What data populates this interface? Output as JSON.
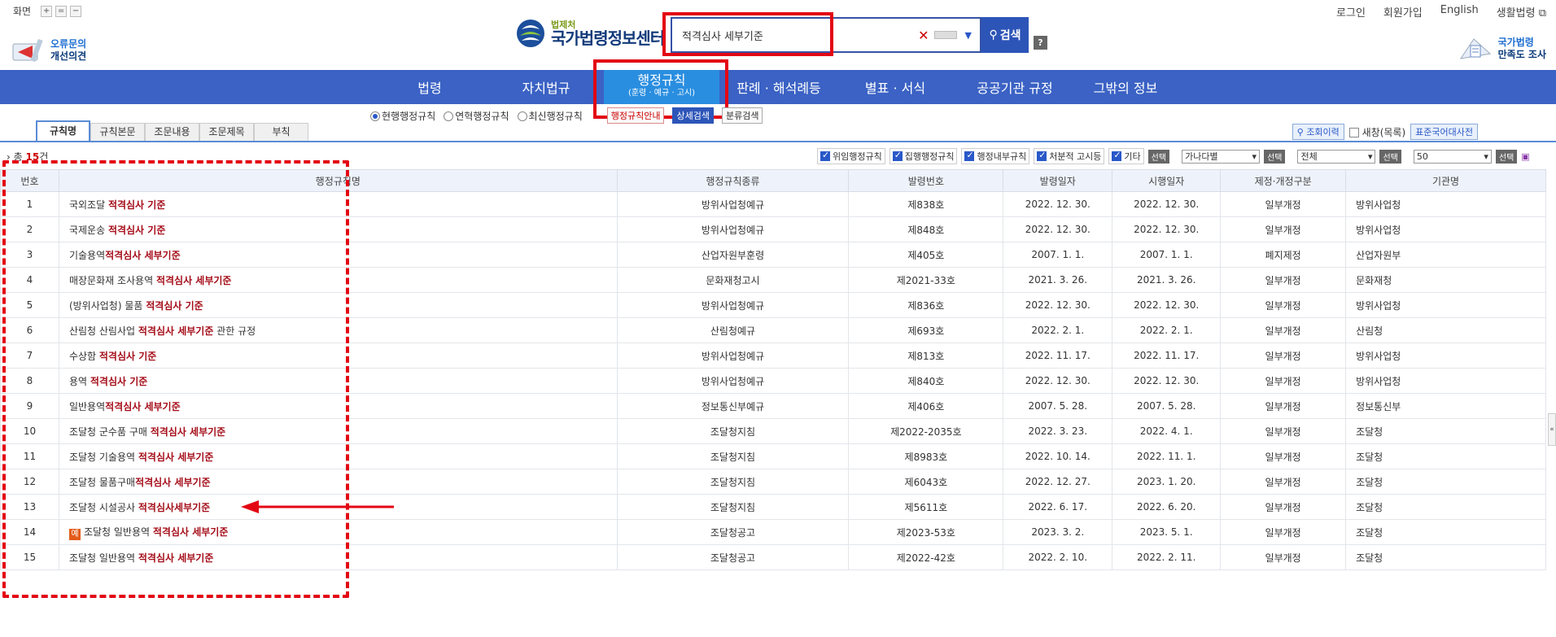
{
  "top": {
    "screen_label": "화면",
    "zoom_buttons": [
      "+",
      "=",
      "−"
    ],
    "links": [
      "로그인",
      "회원가입",
      "English",
      "생활법령"
    ],
    "left_promo": {
      "line1": "오류문의",
      "line2": "개선의견"
    },
    "right_promo": {
      "line1": "국가법령",
      "line2": "만족도 조사"
    },
    "logo": {
      "sub": "법제처",
      "main": "국가법령정보센터"
    }
  },
  "search": {
    "value": "적격심사 세부기준",
    "button": "검색",
    "help": "?"
  },
  "nav": {
    "items": [
      "법령",
      "자치법규",
      "행정규칙",
      "판례 · 해석례등",
      "별표 · 서식",
      "공공기관 규정",
      "그밖의 정보"
    ],
    "active_sub": "(훈령 · 예규 · 고시)"
  },
  "options": {
    "radios": [
      "현행행정규칙",
      "연혁행정규칙",
      "최신행정규칙"
    ],
    "btn_info": "행정규칙안내",
    "btn_detail": "상세검색",
    "btn_class": "분류검색"
  },
  "tabs": [
    "규칙명",
    "규칙본문",
    "조문내용",
    "조문제목",
    "부칙"
  ],
  "tab_tools": {
    "history": "조회이력",
    "newwin": "새창(목록)",
    "lang": "표준국어대사전"
  },
  "count": {
    "prefix": "총 ",
    "num": "15",
    "suffix": "건"
  },
  "filters": {
    "checks": [
      "위임행정규칙",
      "집행행정규칙",
      "행정내부규칙",
      "처분적 고시등",
      "기타"
    ],
    "select_btn": "선택",
    "sort": "가나다별",
    "scope": "전체",
    "per_page": "50"
  },
  "table": {
    "headers": [
      "번호",
      "행정규칙명",
      "행정규칙종류",
      "발령번호",
      "발령일자",
      "시행일자",
      "제정·개정구분",
      "기관명"
    ],
    "rows": [
      {
        "no": "1",
        "pre": "국외조달 ",
        "hl": "적격심사 기준",
        "post": "",
        "tag": "",
        "kind": "방위사업청예규",
        "num": "제838호",
        "issue": "2022. 12. 30.",
        "eff": "2022. 12. 30.",
        "type": "일부개정",
        "org": "방위사업청"
      },
      {
        "no": "2",
        "pre": "국제운송 ",
        "hl": "적격심사 기준",
        "post": "",
        "tag": "",
        "kind": "방위사업청예규",
        "num": "제848호",
        "issue": "2022. 12. 30.",
        "eff": "2022. 12. 30.",
        "type": "일부개정",
        "org": "방위사업청"
      },
      {
        "no": "3",
        "pre": "기술용역",
        "hl": "적격심사 세부기준",
        "post": "",
        "tag": "",
        "kind": "산업자원부훈령",
        "num": "제405호",
        "issue": "2007. 1. 1.",
        "eff": "2007. 1. 1.",
        "type": "폐지제정",
        "org": "산업자원부"
      },
      {
        "no": "4",
        "pre": "매장문화재 조사용역 ",
        "hl": "적격심사 세부기준",
        "post": "",
        "tag": "",
        "kind": "문화재청고시",
        "num": "제2021-33호",
        "issue": "2021. 3. 26.",
        "eff": "2021. 3. 26.",
        "type": "일부개정",
        "org": "문화재청"
      },
      {
        "no": "5",
        "pre": "(방위사업청) 물품 ",
        "hl": "적격심사 기준",
        "post": "",
        "tag": "",
        "kind": "방위사업청예규",
        "num": "제836호",
        "issue": "2022. 12. 30.",
        "eff": "2022. 12. 30.",
        "type": "일부개정",
        "org": "방위사업청"
      },
      {
        "no": "6",
        "pre": "산림청 산림사업 ",
        "hl": "적격심사 세부기준",
        "post": " 관한 규정",
        "tag": "",
        "kind": "산림청예규",
        "num": "제693호",
        "issue": "2022. 2. 1.",
        "eff": "2022. 2. 1.",
        "type": "일부개정",
        "org": "산림청"
      },
      {
        "no": "7",
        "pre": "수상함 ",
        "hl": "적격심사 기준",
        "post": "",
        "tag": "",
        "kind": "방위사업청예규",
        "num": "제813호",
        "issue": "2022. 11. 17.",
        "eff": "2022. 11. 17.",
        "type": "일부개정",
        "org": "방위사업청"
      },
      {
        "no": "8",
        "pre": "용역 ",
        "hl": "적격심사 기준",
        "post": "",
        "tag": "",
        "kind": "방위사업청예규",
        "num": "제840호",
        "issue": "2022. 12. 30.",
        "eff": "2022. 12. 30.",
        "type": "일부개정",
        "org": "방위사업청"
      },
      {
        "no": "9",
        "pre": "일반용역",
        "hl": "적격심사 세부기준",
        "post": "",
        "tag": "",
        "kind": "정보통신부예규",
        "num": "제406호",
        "issue": "2007. 5. 28.",
        "eff": "2007. 5. 28.",
        "type": "일부개정",
        "org": "정보통신부"
      },
      {
        "no": "10",
        "pre": "조달청 군수품 구매 ",
        "hl": "적격심사 세부기준",
        "post": "",
        "tag": "",
        "kind": "조달청지침",
        "num": "제2022-2035호",
        "issue": "2022. 3. 23.",
        "eff": "2022. 4. 1.",
        "type": "일부개정",
        "org": "조달청"
      },
      {
        "no": "11",
        "pre": "조달청 기술용역 ",
        "hl": "적격심사 세부기준",
        "post": "",
        "tag": "",
        "kind": "조달청지침",
        "num": "제8983호",
        "issue": "2022. 10. 14.",
        "eff": "2022. 11. 1.",
        "type": "일부개정",
        "org": "조달청"
      },
      {
        "no": "12",
        "pre": "조달청 물품구매",
        "hl": "적격심사 세부기준",
        "post": "",
        "tag": "",
        "kind": "조달청지침",
        "num": "제6043호",
        "issue": "2022. 12. 27.",
        "eff": "2023. 1. 20.",
        "type": "일부개정",
        "org": "조달청"
      },
      {
        "no": "13",
        "pre": "조달청 시설공사 ",
        "hl": "적격심사세부기준",
        "post": "",
        "tag": "",
        "kind": "조달청지침",
        "num": "제5611호",
        "issue": "2022. 6. 17.",
        "eff": "2022. 6. 20.",
        "type": "일부개정",
        "org": "조달청"
      },
      {
        "no": "14",
        "pre": "조달청 일반용역 ",
        "hl": "적격심사 세부기준",
        "post": "",
        "tag": "예",
        "kind": "조달청공고",
        "num": "제2023-53호",
        "issue": "2023. 3. 2.",
        "eff": "2023. 5. 1.",
        "type": "일부개정",
        "org": "조달청"
      },
      {
        "no": "15",
        "pre": "조달청 일반용역 ",
        "hl": "적격심사 세부기준",
        "post": "",
        "tag": "",
        "kind": "조달청공고",
        "num": "제2022-42호",
        "issue": "2022. 2. 10.",
        "eff": "2022. 2. 11.",
        "type": "일부개정",
        "org": "조달청"
      }
    ]
  },
  "colors": {
    "nav": "#3b62c4",
    "nav_active": "#2a8ee0",
    "highlight": "#a50e1a",
    "annotation": "#e30613"
  }
}
